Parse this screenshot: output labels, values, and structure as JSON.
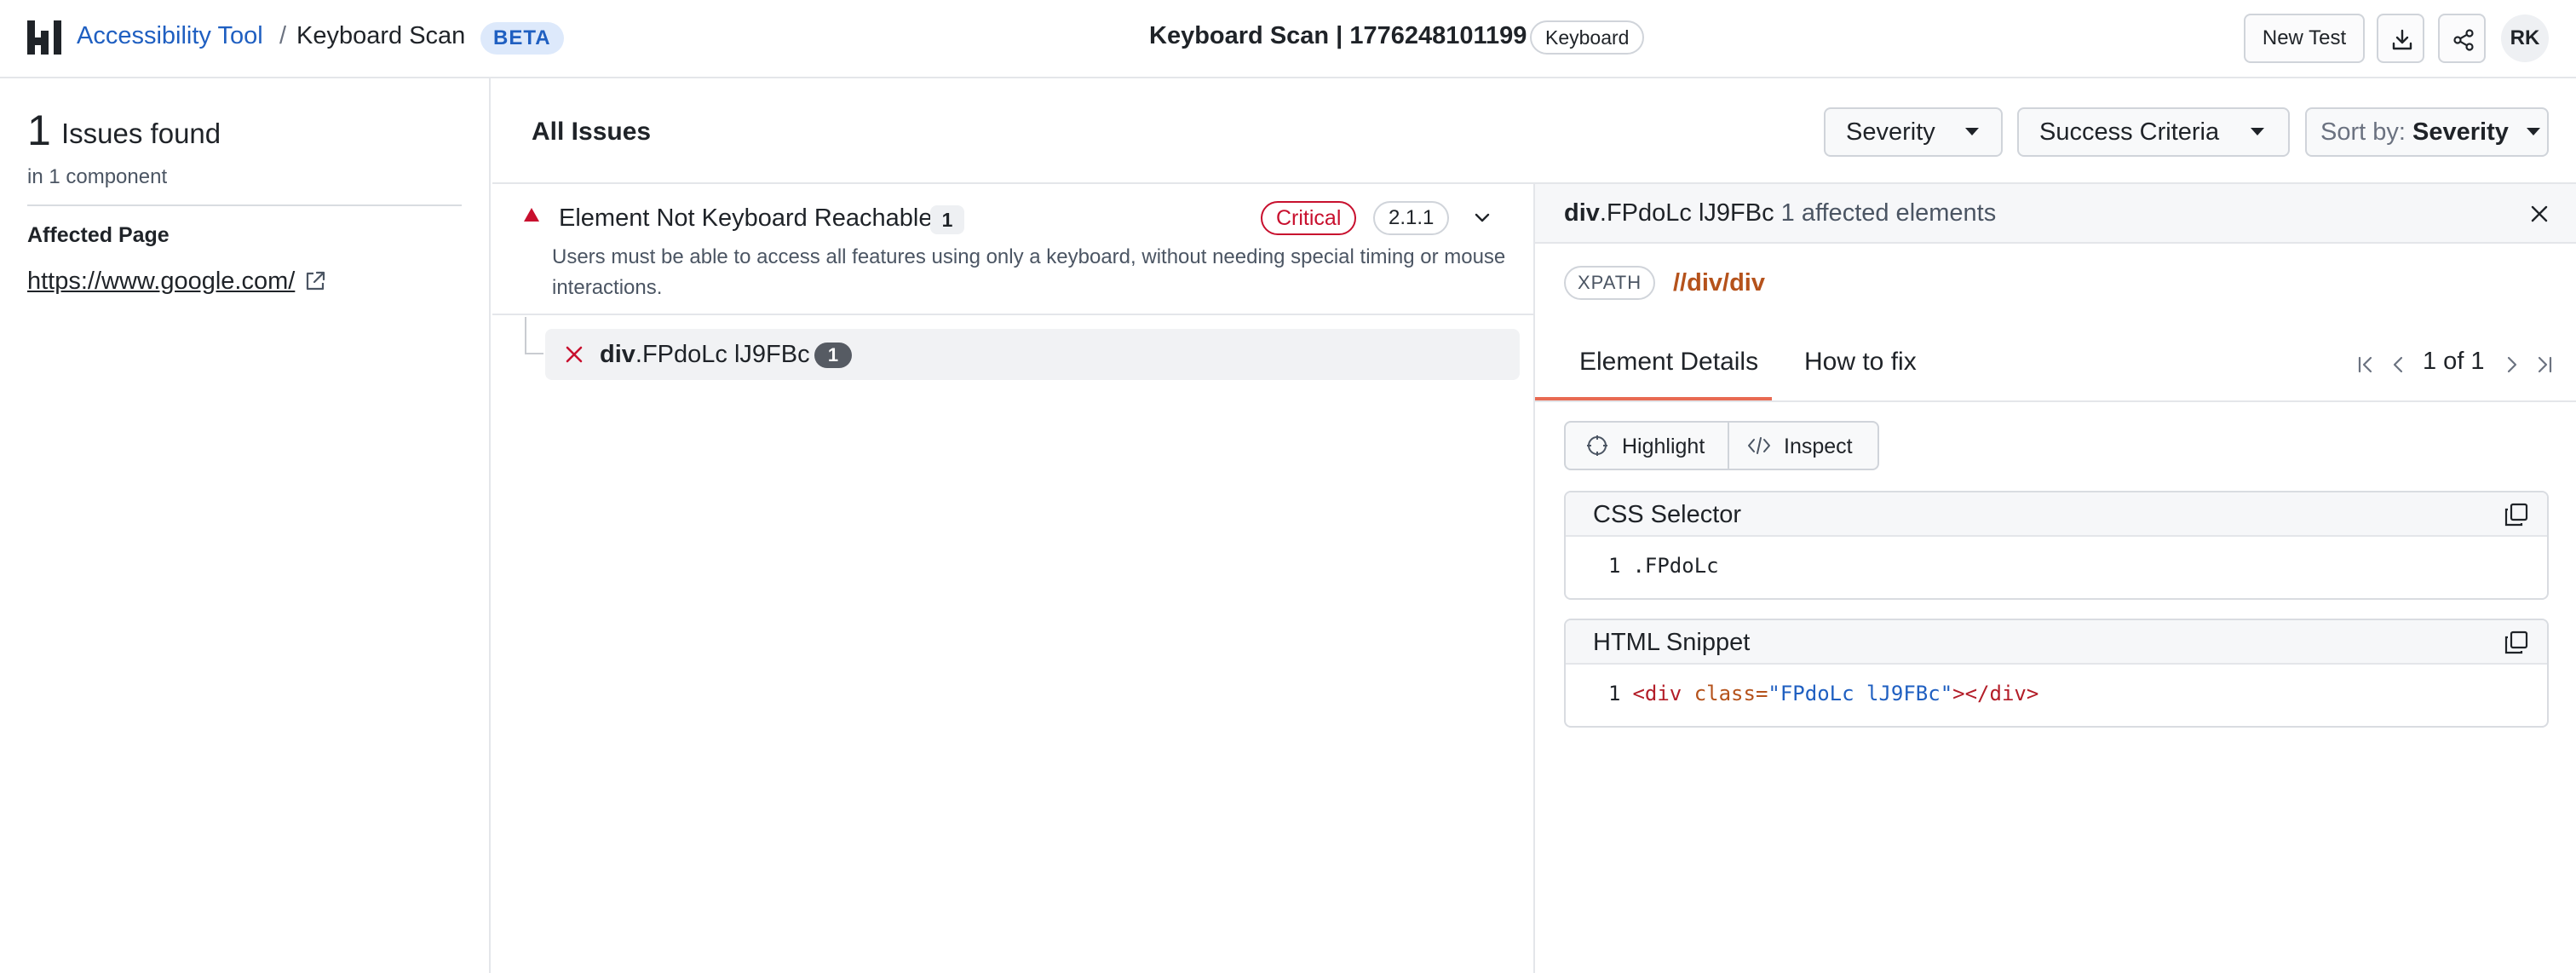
{
  "header": {
    "breadcrumb_root": "Accessibility Tool",
    "breadcrumb_sep": "/",
    "breadcrumb_current": "Keyboard Scan",
    "beta_badge": "BETA",
    "scan_title": "Keyboard Scan | 1776248101199",
    "scan_type_chip": "Keyboard",
    "new_test_label": "New Test",
    "avatar_initials": "RK"
  },
  "sidebar": {
    "issue_count": "1",
    "issue_count_label": "Issues found",
    "component_line": "in 1 component",
    "affected_page_label": "Affected Page",
    "affected_page_url": "https://www.google.com/"
  },
  "filters": {
    "all_issues": "All Issues",
    "severity": "Severity",
    "success_criteria": "Success Criteria",
    "sort_prefix": "Sort by:",
    "sort_value": "Severity"
  },
  "issue": {
    "title": "Element Not Keyboard Reachable",
    "count": "1",
    "severity": "Critical",
    "wcag": "2.1.1",
    "description": "Users must be able to access all features using only a keyboard, without needing special timing or mouse interactions."
  },
  "element": {
    "tag": "div",
    "classes": ".FPdoLc lJ9FBc",
    "count": "1"
  },
  "detail": {
    "tag": "div",
    "classes": ".FPdoLc lJ9FBc",
    "affected_text": "1 affected elements",
    "xpath_label": "XPATH",
    "xpath_value": "//div/div",
    "tab_details": "Element Details",
    "tab_fix": "How to fix",
    "pager_text": "1 of 1",
    "highlight_label": "Highlight",
    "inspect_label": "Inspect",
    "css_selector_title": "CSS Selector",
    "css_line_no": "1",
    "css_selector_value": ".FPdoLc",
    "html_snippet_title": "HTML Snippet",
    "html_line_no": "1",
    "html_open_tag": "<div ",
    "html_attr": "class=",
    "html_value": "\"FPdoLc lJ9FBc\"",
    "html_close": "></div>"
  },
  "colors": {
    "accent_blue": "#1f5fc1",
    "critical_red": "#c8102e",
    "tab_underline": "#e86a52",
    "xpath_orange": "#b5521b"
  },
  "icons": {
    "logo": "logo-icon",
    "download": "download-icon",
    "share": "share-icon",
    "external_link": "external-link-icon",
    "severity": "triangle-up-icon",
    "expand": "chevron-down-icon",
    "fail": "x-icon",
    "close": "close-icon",
    "highlight": "crosshair-icon",
    "inspect": "code-icon",
    "copy": "copy-icon"
  }
}
